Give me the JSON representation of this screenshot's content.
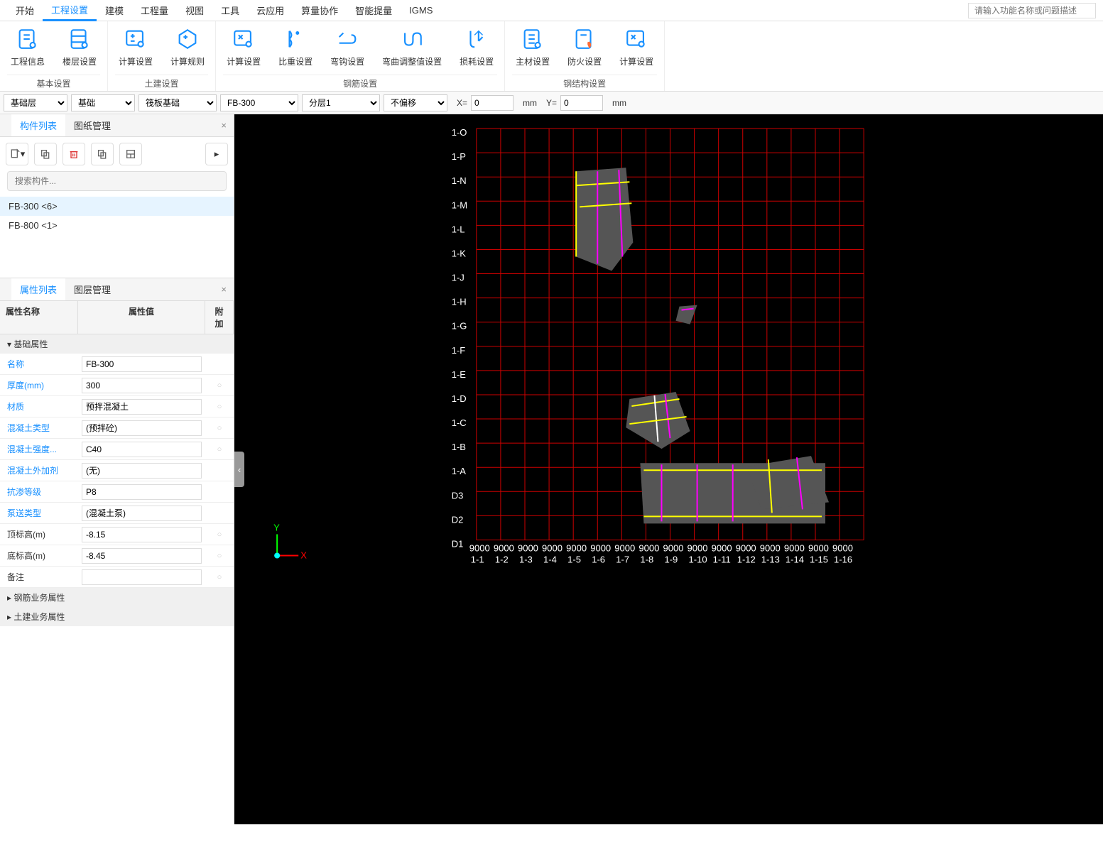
{
  "search_placeholder": "请输入功能名称或问题描述",
  "menubar": [
    "开始",
    "工程设置",
    "建模",
    "工程量",
    "视图",
    "工具",
    "云应用",
    "算量协作",
    "智能提量",
    "IGMS"
  ],
  "menubar_active": 1,
  "ribbon": {
    "groups": [
      {
        "title": "基本设置",
        "buttons": [
          {
            "label": "工程信息"
          },
          {
            "label": "楼层设置"
          }
        ]
      },
      {
        "title": "土建设置",
        "buttons": [
          {
            "label": "计算设置"
          },
          {
            "label": "计算规则"
          }
        ]
      },
      {
        "title": "钢筋设置",
        "buttons": [
          {
            "label": "计算设置"
          },
          {
            "label": "比重设置"
          },
          {
            "label": "弯钩设置"
          },
          {
            "label": "弯曲调整值设置"
          },
          {
            "label": "损耗设置"
          }
        ]
      },
      {
        "title": "钢结构设置",
        "buttons": [
          {
            "label": "主材设置"
          },
          {
            "label": "防火设置"
          },
          {
            "label": "计算设置"
          }
        ]
      }
    ]
  },
  "context": {
    "sel1": "基础层",
    "sel2": "基础",
    "sel3": "筏板基础",
    "sel4": "FB-300",
    "sel5": "分层1",
    "sel6": "不偏移",
    "x_label": "X=",
    "x_val": "0",
    "x_unit": "mm",
    "y_label": "Y=",
    "y_val": "0",
    "y_unit": "mm"
  },
  "panels": {
    "top_tabs": [
      "构件列表",
      "图纸管理"
    ],
    "top_active": 0,
    "search_placeholder": "搜索构件...",
    "components": [
      {
        "name": "FB-300 <6>",
        "selected": true
      },
      {
        "name": "FB-800 <1>",
        "selected": false
      }
    ],
    "bottom_tabs": [
      "属性列表",
      "图层管理"
    ],
    "bottom_active": 0
  },
  "properties": {
    "header": {
      "name": "属性名称",
      "value": "属性值",
      "extra": "附加"
    },
    "section1": "基础属性",
    "rows": [
      {
        "name": "名称",
        "value": "FB-300",
        "blue": true,
        "extra": ""
      },
      {
        "name": "厚度(mm)",
        "value": "300",
        "blue": true,
        "extra": "○"
      },
      {
        "name": "材质",
        "value": "预拌混凝土",
        "blue": true,
        "extra": "○"
      },
      {
        "name": "混凝土类型",
        "value": "(预拌砼)",
        "blue": true,
        "extra": "○"
      },
      {
        "name": "混凝土强度...",
        "value": "C40",
        "blue": true,
        "extra": "○"
      },
      {
        "name": "混凝土外加剂",
        "value": "(无)",
        "blue": true,
        "extra": ""
      },
      {
        "name": "抗渗等级",
        "value": "P8",
        "blue": true,
        "extra": ""
      },
      {
        "name": "泵送类型",
        "value": "(混凝土泵)",
        "blue": true,
        "extra": ""
      },
      {
        "name": "顶标高(m)",
        "value": "-8.15",
        "blue": false,
        "extra": "○"
      },
      {
        "name": "底标高(m)",
        "value": "-8.45",
        "blue": false,
        "extra": "○"
      },
      {
        "name": "备注",
        "value": "",
        "blue": false,
        "extra": "○"
      }
    ],
    "section2": "钢筋业务属性",
    "section3": "土建业务属性"
  },
  "canvas": {
    "row_labels": [
      "1-O",
      "1-P",
      "1-N",
      "1-M",
      "1-L",
      "1-K",
      "1-J",
      "1-H",
      "1-G",
      "1-F",
      "1-E",
      "1-D",
      "1-C",
      "1-B",
      "1-A",
      "D3",
      "D2",
      "D1"
    ],
    "col_labels": [
      "1-1",
      "1-2",
      "1-3",
      "1-4",
      "1-5",
      "1-6",
      "1-7",
      "1-8",
      "1-9",
      "1-10",
      "1-11",
      "1-12",
      "1-13",
      "1-14",
      "1-15",
      "1-16"
    ],
    "dim_label": "9000",
    "y_axis": "Y",
    "x_axis": "X"
  }
}
